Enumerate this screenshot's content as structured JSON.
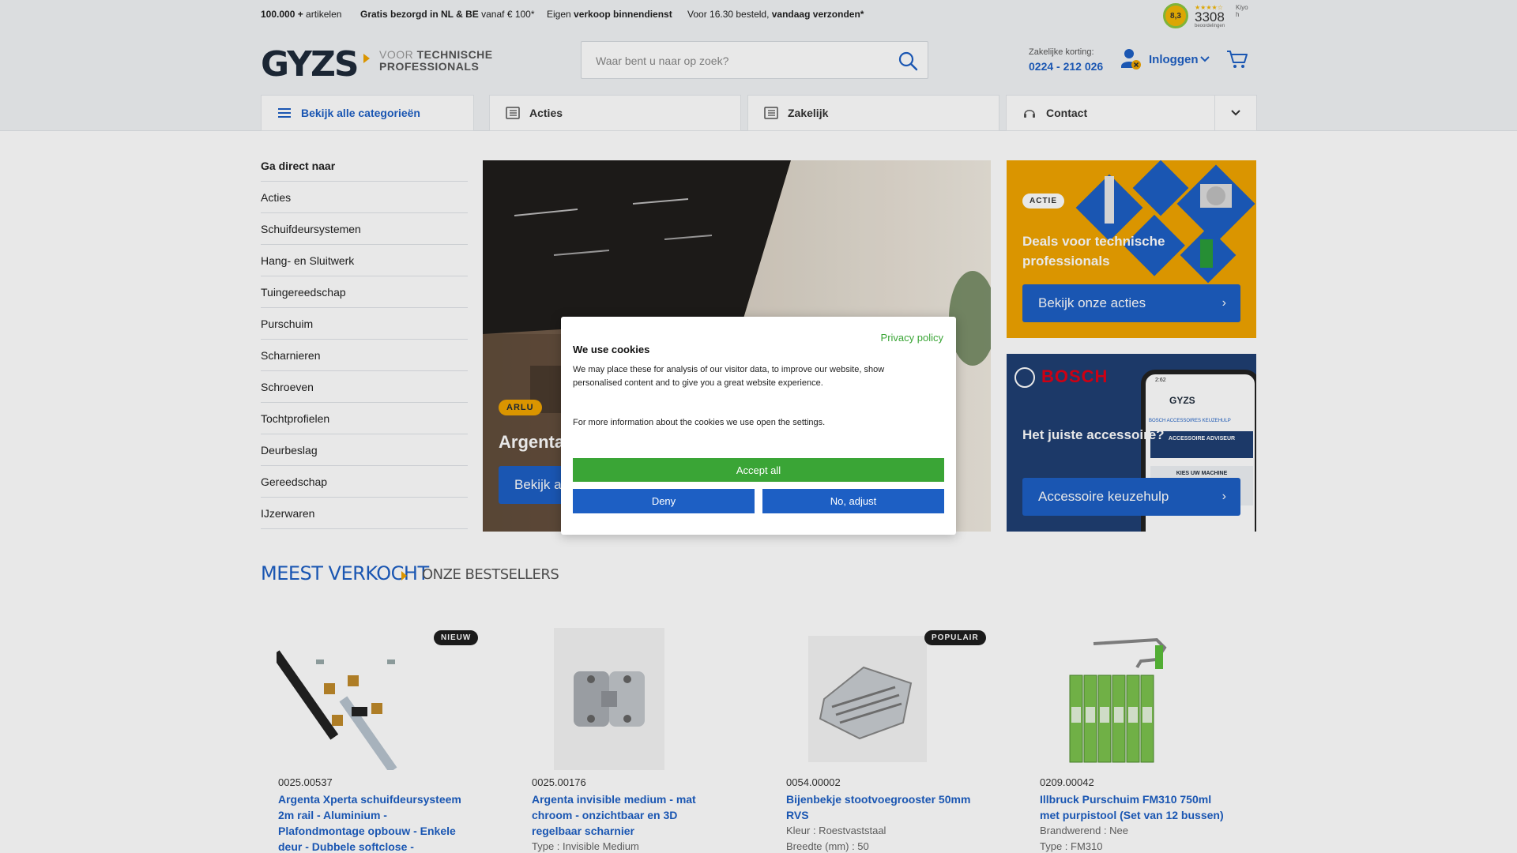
{
  "usp": {
    "articles_bold": "100.000 +",
    "articles_rest": " artikelen",
    "delivery_bold": "Gratis bezorgd in NL & BE",
    "delivery_rest": " vanaf € 100*",
    "sales_pre": "Eigen ",
    "sales_bold": "verkoop binnendienst",
    "ship_pre": "Voor 16.30 besteld, ",
    "ship_bold": "vandaag verzonden*"
  },
  "kiyoh": {
    "score": "8,3",
    "stars": "★★★★☆",
    "count": "3308",
    "label": "beoordelingen",
    "brand": "Kiyo h"
  },
  "header": {
    "logo": "GYZS",
    "tagline_light": "VOOR",
    "tagline_bold_1": "TECHNISCHE",
    "tagline_bold_2": "PROFESSIONALS",
    "search_placeholder": "Waar bent u naar op zoek?",
    "business_label": "Zakelijke korting:",
    "business_phone": "0224 - 212 026",
    "login_label": "Inloggen"
  },
  "nav": {
    "categories": "Bekijk alle categorieën",
    "actions": "Acties",
    "business": "Zakelijk",
    "contact": "Contact"
  },
  "sidebar": {
    "title": "Ga direct naar",
    "items": [
      "Acties",
      "Schuifdeursystemen",
      "Hang- en Sluitwerk",
      "Tuingereedschap",
      "Purschuim",
      "Scharnieren",
      "Schroeven",
      "Tochtprofielen",
      "Deurbeslag",
      "Gereedschap",
      "IJzerwaren"
    ]
  },
  "hero": {
    "badge": "ARLU",
    "title": "Argenta",
    "button": "Bekijk a"
  },
  "promos": {
    "actie_badge": "ACTIE",
    "actie_title": "Deals voor technische professionals",
    "actie_button": "Bekijk onze acties",
    "bosch_logo": "BOSCH",
    "bosch_title": "Het juiste accessoire?",
    "bosch_button": "Accessoire keuzehulp",
    "phone_time": "2:62",
    "phone_logo": "GYZS",
    "phone_line": "BOSCH ACCESSOIRES KEUZEHULP",
    "phone_box": "ACCESSOIRE ADVISEUR",
    "phone_box2": "KIES UW MACHINE"
  },
  "bestsellers": {
    "title": "MEEST VERKOCHT",
    "subtitle": "ONZE BESTSELLERS",
    "products": [
      {
        "badge": "NIEUW",
        "sku": "0025.00537",
        "name": "Argenta Xperta schuifdeursysteem 2m rail - Aluminium - Plafondmontage opbouw - Enkele deur - Dubbele softclose -",
        "attr1": "",
        "attr2": ""
      },
      {
        "badge": "",
        "sku": "0025.00176",
        "name": "Argenta invisible medium - mat chroom - onzichtbaar en 3D regelbaar scharnier",
        "attr1": "Type : Invisible Medium",
        "attr2": ""
      },
      {
        "badge": "POPULAIR",
        "sku": "0054.00002",
        "name": "Bijenbekje stootvoegrooster 50mm RVS",
        "attr1": "Kleur : Roestvaststaal",
        "attr2": "Breedte (mm) : 50"
      },
      {
        "badge": "",
        "sku": "0209.00042",
        "name": "Illbruck Purschuim FM310 750ml met purpistool (Set van 12 bussen)",
        "attr1": "Brandwerend : Nee",
        "attr2": "Type : FM310"
      }
    ]
  },
  "cookie": {
    "privacy": "Privacy policy",
    "title": "We use cookies",
    "text": "We may place these for analysis of our visitor data, to improve our website, show personalised content and to give you a great website experience.",
    "text2": "For more information about the cookies we use open the settings.",
    "accept": "Accept all",
    "deny": "Deny",
    "adjust": "No, adjust"
  },
  "colors": {
    "brand_blue": "#1d5fc4",
    "accent_orange": "#f0a400",
    "cookie_green": "#3aa536",
    "logo_dark": "#1e2a3a"
  }
}
